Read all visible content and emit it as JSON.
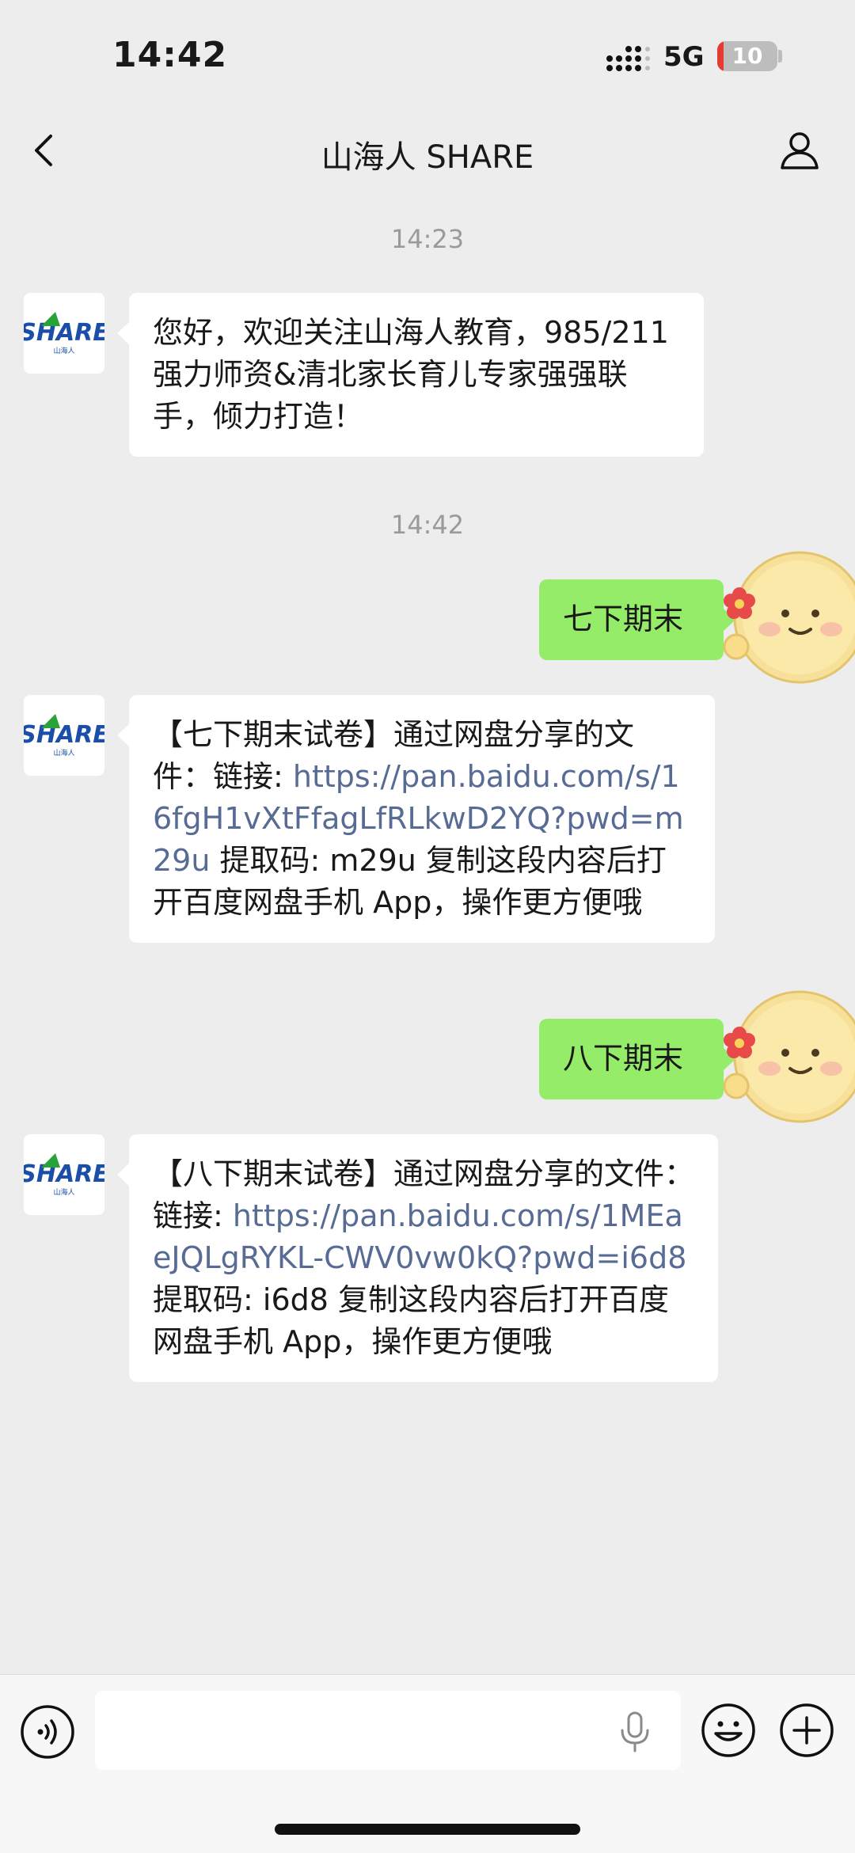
{
  "status_bar": {
    "time": "14:42",
    "network": "5G",
    "battery": "10",
    "battery_level": 0.1
  },
  "nav": {
    "title": "山海人 SHARE",
    "back_icon": "chevron-left-icon",
    "profile_icon": "person-icon"
  },
  "messages": [
    {
      "type": "timestamp",
      "text": "14:23"
    },
    {
      "type": "incoming",
      "sender": "SHARE",
      "text": "您好，欢迎关注山海人教育，985/211强力师资&清北家长育儿专家强强联手，倾力打造！"
    },
    {
      "type": "timestamp",
      "text": "14:42"
    },
    {
      "type": "outgoing",
      "text": "七下期末"
    },
    {
      "type": "incoming",
      "sender": "SHARE",
      "prefix": "【七下期末试卷】通过网盘分享的文件：链接: ",
      "link": "https://pan.baidu.com/s/16fgH1vXtFfagLfRLkwD2YQ?pwd=m29u",
      "suffix": " 提取码: m29u 复制这段内容后打开百度网盘手机 App，操作更方便哦"
    },
    {
      "type": "outgoing",
      "text": "八下期末"
    },
    {
      "type": "incoming",
      "sender": "SHARE",
      "prefix": "【八下期末试卷】通过网盘分享的文件：链接: ",
      "link": "https://pan.baidu.com/s/1MEaeJQLgRYKL-CWV0vw0kQ?pwd=i6d8",
      "suffix": " 提取码: i6d8 复制这段内容后打开百度网盘手机 App，操作更方便哦"
    }
  ],
  "avatar_logo": {
    "text": "SHARE",
    "subtext": "山海人"
  },
  "input_bar": {
    "placeholder": "",
    "voice_icon": "voice-icon",
    "mic_icon": "mic-icon",
    "emoji_icon": "emoji-icon",
    "plus_icon": "plus-icon"
  },
  "colors": {
    "background": "#ededed",
    "outgoing_bubble": "#95ec69",
    "incoming_bubble": "#ffffff",
    "link": "#576b95",
    "timestamp": "#9a9a9a"
  }
}
